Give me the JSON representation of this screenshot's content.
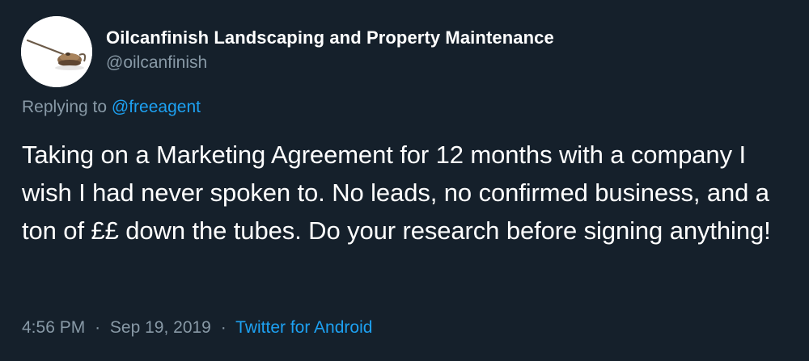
{
  "user": {
    "display_name": "Oilcanfinish Landscaping and Property Maintenance",
    "handle": "@oilcanfinish",
    "avatar_icon": "oil-can-icon"
  },
  "reply": {
    "prefix": "Replying to",
    "mention": "@freeagent"
  },
  "tweet": {
    "text": "Taking on a Marketing Agreement for 12 months with a company I wish I had never spoken to. No leads, no confirmed business, and a ton of ££ down the tubes. Do your research before signing anything!"
  },
  "meta": {
    "time": "4:56 PM",
    "separator": "·",
    "date": "Sep 19, 2019",
    "source": "Twitter for Android"
  },
  "colors": {
    "background": "#15202b",
    "text": "#ffffff",
    "muted": "#8899a6",
    "link": "#1da1f2"
  }
}
